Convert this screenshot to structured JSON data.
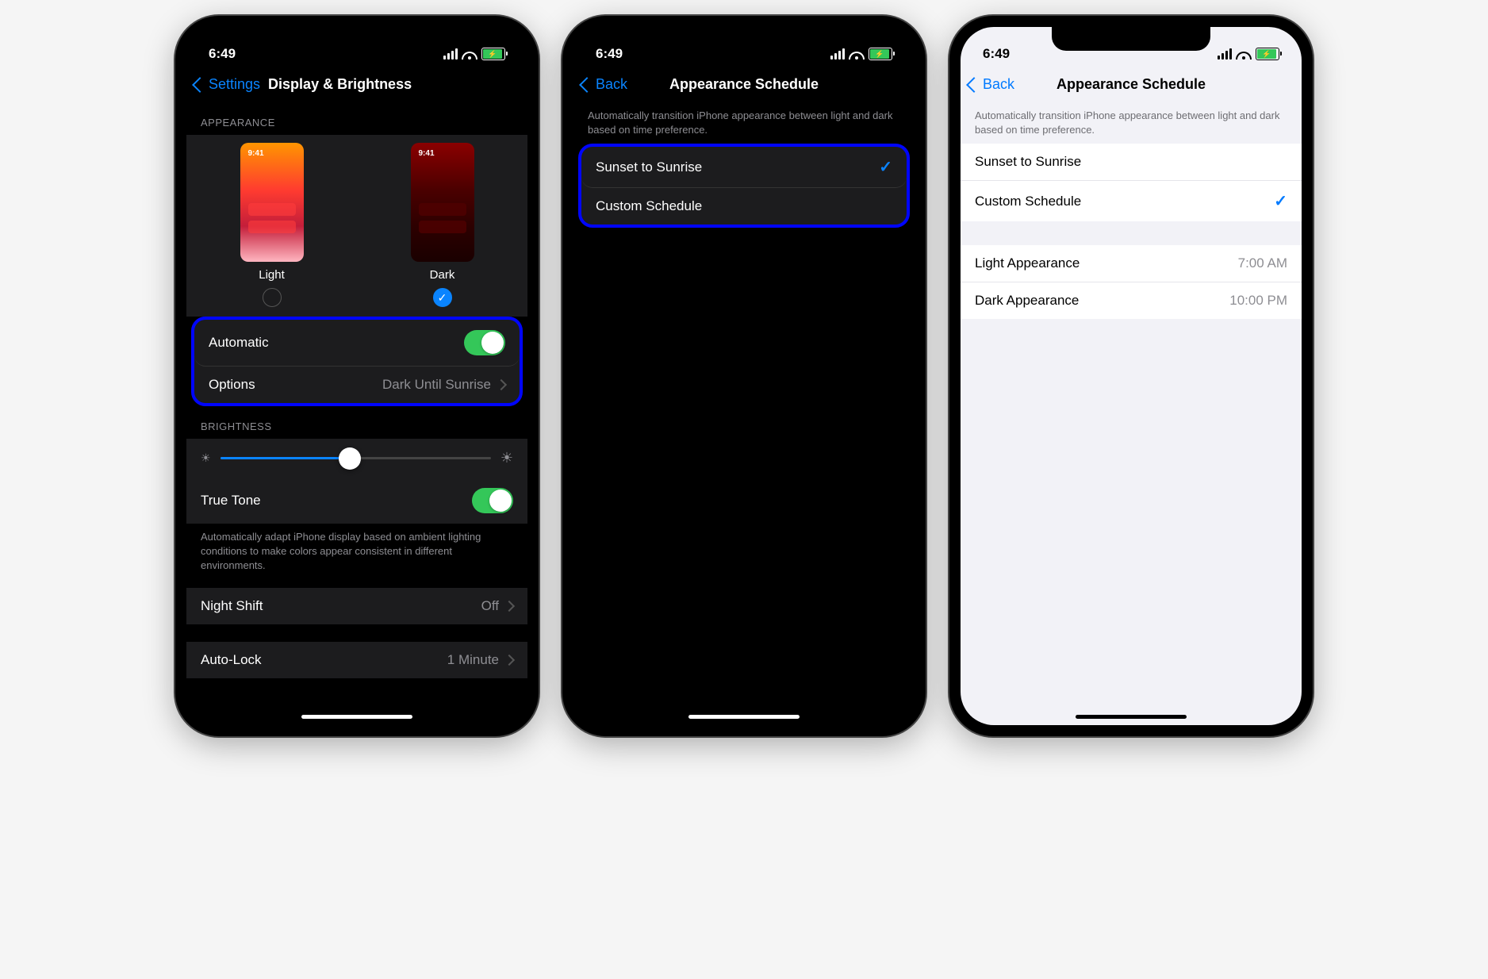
{
  "status": {
    "time": "6:49"
  },
  "screen1": {
    "back_label": "Settings",
    "title": "Display & Brightness",
    "appearance_header": "APPEARANCE",
    "light_label": "Light",
    "dark_label": "Dark",
    "preview_time": "9:41",
    "automatic_label": "Automatic",
    "options_label": "Options",
    "options_value": "Dark Until Sunrise",
    "brightness_header": "BRIGHTNESS",
    "truetone_label": "True Tone",
    "truetone_desc": "Automatically adapt iPhone display based on ambient lighting conditions to make colors appear consistent in different environments.",
    "nightshift_label": "Night Shift",
    "nightshift_value": "Off",
    "autolock_label": "Auto-Lock",
    "autolock_value": "1 Minute"
  },
  "screen2": {
    "back_label": "Back",
    "title": "Appearance Schedule",
    "desc": "Automatically transition iPhone appearance between light and dark based on time preference.",
    "option1": "Sunset to Sunrise",
    "option2": "Custom Schedule",
    "selected": "option1"
  },
  "screen3": {
    "back_label": "Back",
    "title": "Appearance Schedule",
    "desc": "Automatically transition iPhone appearance between light and dark based on time preference.",
    "option1": "Sunset to Sunrise",
    "option2": "Custom Schedule",
    "selected": "option2",
    "light_appearance_label": "Light Appearance",
    "light_appearance_time": "7:00 AM",
    "dark_appearance_label": "Dark Appearance",
    "dark_appearance_time": "10:00 PM"
  }
}
